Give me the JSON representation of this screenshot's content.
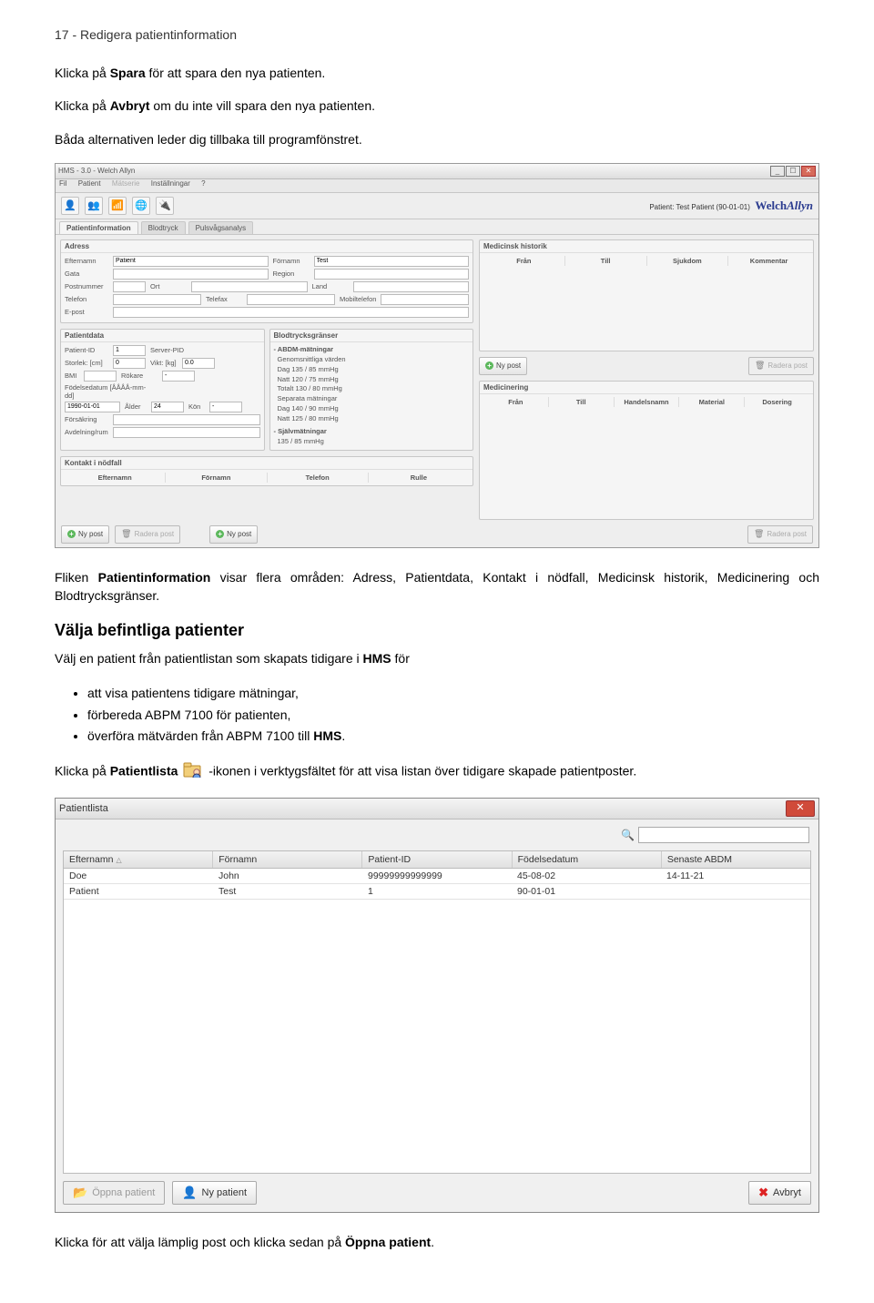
{
  "header": "17 - Redigera patientinformation",
  "intro": {
    "p1_pre": "Klicka på ",
    "p1_b1": "Spara",
    "p1_mid": " för att spara den nya patienten.",
    "p2_pre": "Klicka på ",
    "p2_b1": "Avbryt",
    "p2_mid": " om du inte vill spara den nya patienten.",
    "p3": "Båda alternativen leder dig tillbaka till programfönstret."
  },
  "screenshot1": {
    "title": "HMS - 3.0 - Welch Allyn",
    "menu": {
      "m1": "Fil",
      "m2": "Patient",
      "m3": "Mätserie",
      "m4": "Inställningar",
      "m5": "?"
    },
    "patient_label": "Patient: Test Patient (90-01-01)",
    "brand": "WelchAllyn",
    "tabs": {
      "t1": "Patientinformation",
      "t2": "Blodtryck",
      "t3": "Pulsvågsanalys"
    },
    "address": {
      "hdr": "Adress",
      "efternamn": "Efternamn",
      "efternamn_v": "Patient",
      "fornamn": "Förnamn",
      "fornamn_v": "Test",
      "gata": "Gata",
      "region": "Region",
      "postnummer": "Postnummer",
      "ort": "Ort",
      "land": "Land",
      "telefon": "Telefon",
      "telefax": "Telefax",
      "mobil": "Mobiltelefon",
      "epost": "E-post"
    },
    "medhist": {
      "hdr": "Medicinsk historik",
      "c1": "Från",
      "c2": "Till",
      "c3": "Sjukdom",
      "c4": "Kommentar",
      "nypost": "Ny post",
      "radera": "Radera post"
    },
    "patientdata": {
      "hdr": "Patientdata",
      "pid": "Patient-ID",
      "pid_v": "1",
      "serverpid": "Server-PID",
      "storlek": "Storlek: [cm]",
      "vikt": "Vikt: [kg]",
      "bmi": "BMI",
      "rokare": "Rökare",
      "storlek_v": "0",
      "vikt_v": "0.0",
      "bmi_v": "",
      "rokare_v": "-",
      "fodelsedatum": "Födelsedatum [ÅÅÅÅ-mm-dd]",
      "fod_v": "1990-01-01",
      "alder": "Ålder",
      "alder_v": "24",
      "kon": "Kön",
      "kon_v": "-",
      "forsakring": "Försäkring",
      "avdelning": "Avdelning/rum"
    },
    "bp": {
      "hdr": "Blodtrycksgränser",
      "l1": "- ABDM-mätningar",
      "l2": "Genomsnittliga värden",
      "l3": "Dag   135 / 85 mmHg",
      "l4": "Natt  120 / 75 mmHg",
      "l5": "Totalt 130 / 80 mmHg",
      "l6": "Separata mätningar",
      "l7": "Dag   140 / 90 mmHg",
      "l8": "Natt  125 / 80 mmHg",
      "l9": "- Självmätningar",
      "l10": "        135 / 85 mmHg"
    },
    "kontakt": {
      "hdr": "Kontakt i nödfall",
      "c1": "Efternamn",
      "c2": "Förnamn",
      "c3": "Telefon",
      "c4": "Rulle"
    },
    "medicinering": {
      "hdr": "Medicinering",
      "c1": "Från",
      "c2": "Till",
      "c3": "Handelsnamn",
      "c4": "Material",
      "c5": "Dosering"
    },
    "bottom": {
      "nypost": "Ny post",
      "radera": "Radera post"
    }
  },
  "mid": {
    "p1_a": "Fliken ",
    "p1_b": "Patientinformation",
    "p1_c": " visar flera områden: Adress, Patientdata, Kontakt i nödfall, Medicinsk historik, Medicinering och Blodtrycksgränser."
  },
  "select": {
    "h": "Välja befintliga patienter",
    "p": "Välj en patient från patientlistan som skapats tidigare i ",
    "p_b": "HMS",
    "p_c": " för",
    "li1": "att visa patientens tidigare mätningar,",
    "li2_a": "förbereda ABPM 7100 för patienten,",
    "li3_a": "överföra mätvärden från ABPM 7100 till ",
    "li3_b": "HMS",
    "li3_c": ".",
    "pl_a": "Klicka på ",
    "pl_b": "Patientlista",
    "pl_c": "-ikonen i verktygsfältet för att visa listan över tidigare skapade patientposter."
  },
  "dlg": {
    "title": "Patientlista",
    "hdr": {
      "c1": "Efternamn",
      "c2": "Förnamn",
      "c3": "Patient-ID",
      "c4": "Födelsedatum",
      "c5": "Senaste ABDM"
    },
    "rows": [
      {
        "c1": "Doe",
        "c2": "John",
        "c3": "99999999999999",
        "c4": "45-08-02",
        "c5": "14-11-21"
      },
      {
        "c1": "Patient",
        "c2": "Test",
        "c3": "1",
        "c4": "90-01-01",
        "c5": ""
      }
    ],
    "btn_open": "Öppna patient",
    "btn_new": "Ny patient",
    "btn_cancel": "Avbryt"
  },
  "closing": {
    "a": "Klicka för att välja lämplig post och klicka sedan på ",
    "b": "Öppna patient",
    "c": "."
  }
}
